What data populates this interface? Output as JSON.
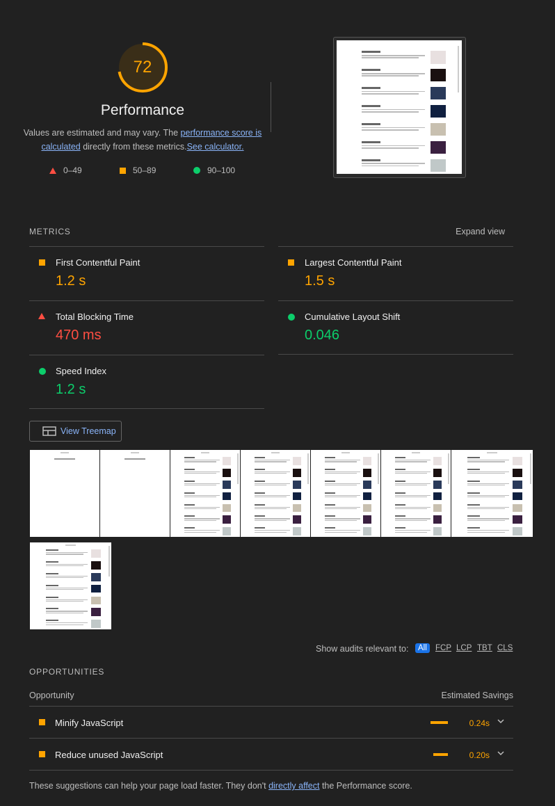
{
  "score": {
    "value": "72",
    "fraction": 0.72,
    "title": "Performance",
    "description_prefix": "Values are estimated and may vary. The ",
    "score_link": "performance score is calculated",
    "description_mid": " directly from these metrics.",
    "calc_link": "See calculator."
  },
  "legend": [
    {
      "label": "0–49",
      "icon": "triangle-icon"
    },
    {
      "label": "50–89",
      "icon": "square-icon"
    },
    {
      "label": "90–100",
      "icon": "circle-icon"
    }
  ],
  "colors": {
    "fail": "#ff4e42",
    "average": "#ffa400",
    "pass": "#0cce6b",
    "link": "#8ab4f8"
  },
  "metrics": {
    "heading": "METRICS",
    "expand": "Expand view",
    "items": [
      {
        "name": "First Contentful Paint",
        "value": "1.2 s"
      },
      {
        "name": "Largest Contentful Paint",
        "value": "1.5 s"
      },
      {
        "name": "Total Blocking Time",
        "value": "470 ms"
      },
      {
        "name": "Cumulative Layout Shift",
        "value": "0.046"
      },
      {
        "name": "Speed Index",
        "value": "1.2 s"
      }
    ]
  },
  "treemap_button": "View Treemap",
  "filters": {
    "label": "Show audits relevant to:",
    "options": [
      "All",
      "FCP",
      "LCP",
      "TBT",
      "CLS"
    ],
    "selected": "All"
  },
  "opportunities": {
    "heading": "OPPORTUNITIES",
    "col_opportunity": "Opportunity",
    "col_savings": "Estimated Savings",
    "items": [
      {
        "name": "Minify JavaScript",
        "savings": "0.24s"
      },
      {
        "name": "Reduce unused JavaScript",
        "savings": "0.20s"
      }
    ]
  },
  "footnote": {
    "prefix": "These suggestions can help your page load faster. They don't ",
    "link": "directly affect",
    "suffix": " the Performance score."
  }
}
